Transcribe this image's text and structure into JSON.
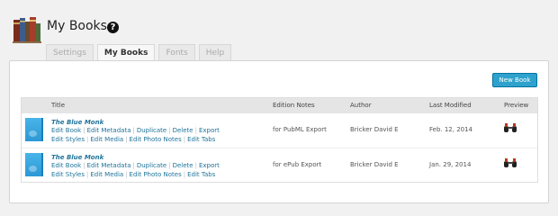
{
  "header": {
    "title": "My Books",
    "help_glyph": "?"
  },
  "tabs": [
    {
      "label": "Settings",
      "active": false
    },
    {
      "label": "My Books",
      "active": true
    },
    {
      "label": "Fonts",
      "active": false
    },
    {
      "label": "Help",
      "active": false
    }
  ],
  "toolbar": {
    "new_book_label": "New Book"
  },
  "table": {
    "columns": {
      "title": "Title",
      "edition_notes": "Edition Notes",
      "author": "Author",
      "last_modified": "Last Modified",
      "preview": "Preview"
    },
    "rows": [
      {
        "title": "The Blue Monk",
        "edition_notes": "for PubML Export",
        "author": "Bricker David E",
        "last_modified": "Feb. 12, 2014",
        "actions_line1": [
          "Edit Book",
          "Edit Metadata",
          "Duplicate",
          "Delete",
          "Export"
        ],
        "actions_line2": [
          "Edit Styles",
          "Edit Media",
          "Edit Photo Notes",
          "Edit Tabs"
        ]
      },
      {
        "title": "The Blue Monk",
        "edition_notes": "for ePub Export",
        "author": "Bricker David E",
        "last_modified": "Jan. 29, 2014",
        "actions_line1": [
          "Edit Book",
          "Edit Metadata",
          "Duplicate",
          "Delete",
          "Export"
        ],
        "actions_line2": [
          "Edit Styles",
          "Edit Media",
          "Edit Photo Notes",
          "Edit Tabs"
        ]
      }
    ]
  },
  "colors": {
    "accent": "#2ea2cc",
    "link": "#21759b",
    "cover": "#2b98d6"
  },
  "icons": {
    "app": "books-icon",
    "help": "question-circle-icon",
    "preview": "binoculars-icon"
  }
}
